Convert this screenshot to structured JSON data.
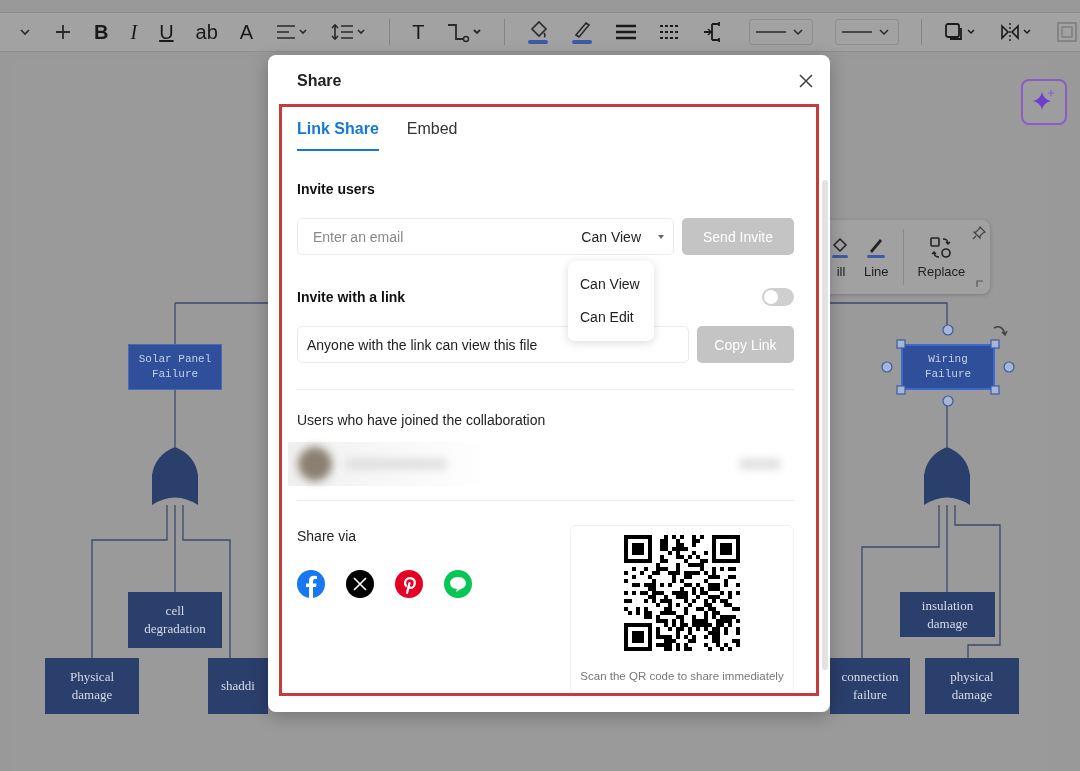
{
  "toolbar": {
    "items": [
      {
        "kind": "caret"
      },
      {
        "kind": "plus"
      },
      {
        "kind": "bold",
        "text": "B"
      },
      {
        "kind": "italic",
        "text": "I"
      },
      {
        "kind": "underline",
        "text": "U"
      },
      {
        "kind": "glyph",
        "text": "ab"
      },
      {
        "kind": "glyph",
        "text": "A"
      },
      {
        "kind": "align"
      },
      {
        "kind": "spacing"
      },
      {
        "kind": "divider"
      },
      {
        "kind": "glyph",
        "text": "T"
      },
      {
        "kind": "connector"
      },
      {
        "kind": "divider"
      },
      {
        "kind": "fill"
      },
      {
        "kind": "pen"
      },
      {
        "kind": "weight"
      },
      {
        "kind": "dash"
      },
      {
        "kind": "branch"
      },
      {
        "kind": "linestyle"
      },
      {
        "kind": "linestyle"
      },
      {
        "kind": "divider"
      },
      {
        "kind": "shadow"
      },
      {
        "kind": "flip"
      },
      {
        "kind": "frame"
      }
    ]
  },
  "diagram": {
    "nodes": [
      {
        "label": "Solar Panel Failure",
        "kind": "event",
        "selected": false
      },
      {
        "label": "cell degradation",
        "kind": "basic",
        "selected": false
      },
      {
        "label": "Physical damage",
        "kind": "basic",
        "selected": false
      },
      {
        "label": "shaddi",
        "kind": "basic",
        "selected": false
      },
      {
        "label": "Wiring Failure",
        "kind": "event",
        "selected": true
      },
      {
        "label": "insulation damage",
        "kind": "basic",
        "selected": false
      },
      {
        "label": "connection failure",
        "kind": "basic",
        "selected": false
      },
      {
        "label": "physical damage",
        "kind": "basic",
        "selected": false
      }
    ]
  },
  "shape_toolbar": {
    "items": [
      {
        "label": "ill",
        "kind": "fill"
      },
      {
        "label": "Line",
        "kind": "line"
      },
      {
        "label": "Replace",
        "kind": "replace"
      }
    ]
  },
  "dialog": {
    "title": "Share",
    "tabs": [
      {
        "label": "Link Share",
        "selected": true
      },
      {
        "label": "Embed",
        "selected": false
      }
    ],
    "invite": {
      "heading": "Invite users",
      "placeholder": "Enter an email",
      "permission": "Can View",
      "button": "Send Invite",
      "button_disabled": true
    },
    "permission_menu": {
      "items": [
        "Can View",
        "Can Edit"
      ]
    },
    "link": {
      "heading": "Invite with a link",
      "on": false,
      "value": "Anyone with the link can view this file",
      "button": "Copy Link",
      "button_disabled": true
    },
    "collaborators": {
      "heading": "Users who have joined the collaboration",
      "users": [
        {
          "kind": "blurred"
        }
      ]
    },
    "share": {
      "heading": "Share via",
      "services": [
        {
          "kind": "facebook"
        },
        {
          "kind": "x"
        },
        {
          "kind": "pinterest"
        },
        {
          "kind": "line"
        }
      ],
      "qr_caption": "Scan the QR code to share immediately"
    }
  }
}
